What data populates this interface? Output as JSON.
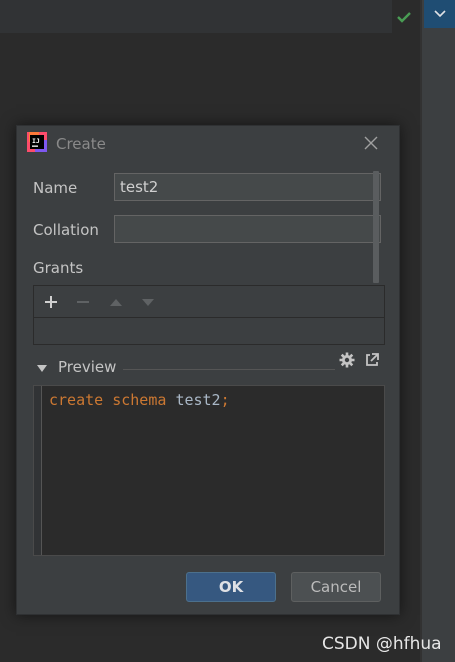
{
  "dialog": {
    "title": "Create",
    "name_label": "Name",
    "name_value": "test2",
    "collation_label": "Collation",
    "collation_value": "",
    "grants_label": "Grants",
    "preview_label": "Preview",
    "code": {
      "kw1": "create",
      "kw2": "schema",
      "ident": "test2",
      "term": ";"
    },
    "ok_label": "OK",
    "cancel_label": "Cancel"
  },
  "watermark": "CSDN @hfhua",
  "colors": {
    "keyword": "#cc7832",
    "identifier": "#a9b7c6",
    "ok_button": "#365880",
    "check": "#499c54"
  }
}
